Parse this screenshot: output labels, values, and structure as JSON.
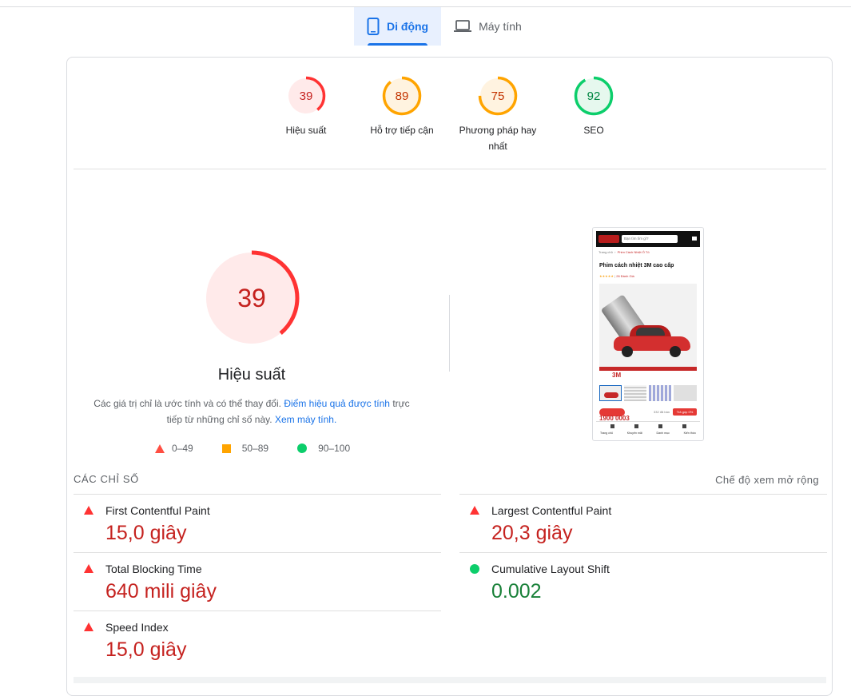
{
  "tabs": [
    {
      "label": "Di động",
      "icon": "smartphone-icon",
      "active": true
    },
    {
      "label": "Máy tính",
      "icon": "laptop-icon",
      "active": false
    }
  ],
  "categories": [
    {
      "score": "39",
      "label": "Hiệu suất",
      "fraction": 0.39,
      "status": "fail"
    },
    {
      "score": "89",
      "label": "Hỗ trợ tiếp cận",
      "fraction": 0.89,
      "status": "average"
    },
    {
      "score": "75",
      "label_line1": "Phương pháp hay",
      "label_line2": "nhất",
      "fraction": 0.75,
      "status": "average"
    },
    {
      "score": "92",
      "label": "SEO",
      "fraction": 0.92,
      "status": "pass"
    }
  ],
  "performance": {
    "score": "39",
    "fraction": 0.39,
    "title": "Hiệu suất",
    "desc_part1": "Các giá trị chỉ là ước tính và có thể thay đổi.",
    "desc_link1": "Điểm hiệu quả được tính",
    "desc_part2": "trực tiếp từ những chỉ số này.",
    "desc_link2": "Xem máy tính."
  },
  "legend": [
    {
      "label": "0–49",
      "shape": "triangle",
      "color": "#ff4e42"
    },
    {
      "label": "50–89",
      "shape": "square",
      "color": "#ffa400"
    },
    {
      "label": "90–100",
      "shape": "circle",
      "color": "#0cce6b"
    }
  ],
  "screenshot": {
    "search_placeholder": "Bạn tìm tìm gì?",
    "breadcrumb_home": "Trang chủ",
    "breadcrumb_current": "Phim Cách Nhiệt Ô Tô",
    "product_title": "Phim cách nhiệt 3M cao cấp",
    "reviews": "26 Đánh Giá",
    "brand": "3M",
    "phone": "1900 0003",
    "sold": "332 đã bán",
    "buy_button": "Trả góp 0%",
    "nav": [
      "Trang chủ",
      "Khuyến mãi",
      "Danh mục",
      "Kiến thức"
    ]
  },
  "metrics": {
    "heading": "CÁC CHỈ SỐ",
    "expand_label": "Chế độ xem mở rộng",
    "items": [
      {
        "name": "First Contentful Paint",
        "value": "15,0 giây",
        "status": "fail"
      },
      {
        "name": "Largest Contentful Paint",
        "value": "20,3 giây",
        "status": "fail"
      },
      {
        "name": "Total Blocking Time",
        "value": "640 mili giây",
        "status": "fail"
      },
      {
        "name": "Cumulative Layout Shift",
        "value": "0.002",
        "status": "pass"
      },
      {
        "name": "Speed Index",
        "value": "15,0 giây",
        "status": "fail"
      }
    ]
  },
  "colors": {
    "fail": "#ff3333",
    "fail_text": "#c5221f",
    "average": "#ffa400",
    "average_text": "#c33300",
    "pass": "#0cce6b",
    "pass_text": "#018642",
    "accent": "#1a73e8"
  }
}
